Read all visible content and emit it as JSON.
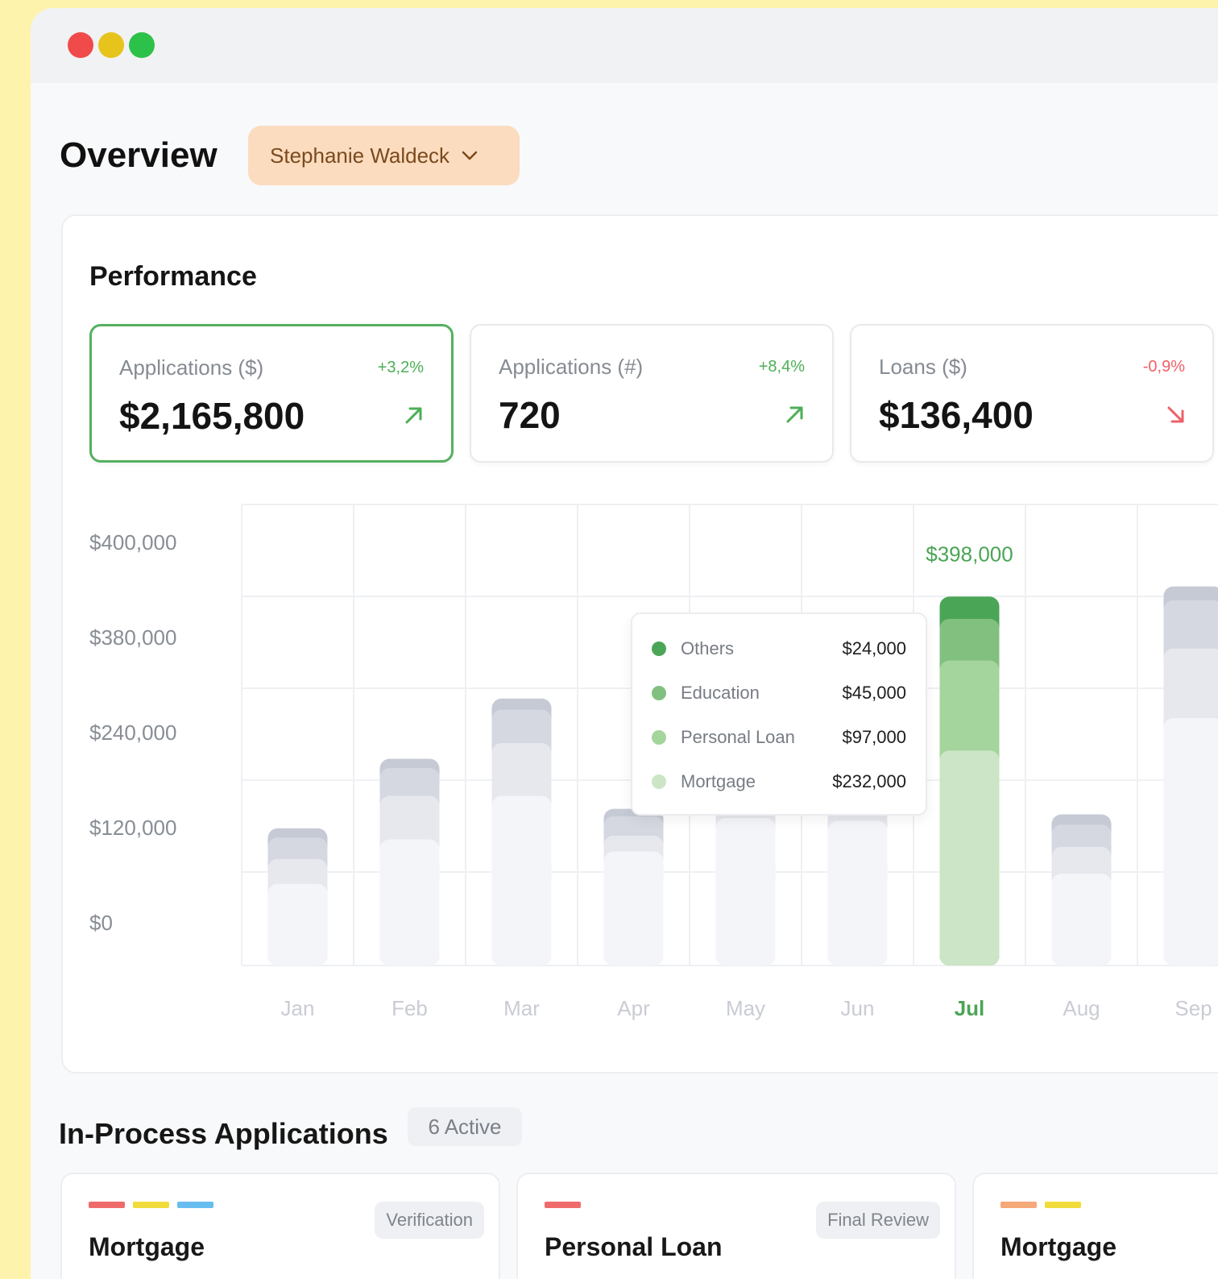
{
  "window": {
    "traffic_lights": {
      "close": "#f04a4a",
      "minimize": "#e7c41c",
      "maximize": "#2cc24a"
    }
  },
  "header": {
    "title": "Overview",
    "user_select": {
      "value": "Stephanie Waldeck",
      "icon": "chevron-down-icon"
    }
  },
  "performance": {
    "title": "Performance",
    "kpis": [
      {
        "label": "Applications ($)",
        "change": "+3,2%",
        "value": "$2,165,800",
        "trend": "up",
        "active": true
      },
      {
        "label": "Applications (#)",
        "change": "+8,4%",
        "value": "720",
        "trend": "up",
        "active": false
      },
      {
        "label": "Loans ($)",
        "change": "-0,9%",
        "value": "$136,400",
        "trend": "down",
        "active": false
      }
    ]
  },
  "chart_data": {
    "type": "bar",
    "stacked": true,
    "y_tick_labels": [
      "$400,000",
      "$380,000",
      "$240,000",
      "$120,000",
      "$0"
    ],
    "categories": [
      "Jan",
      "Feb",
      "Mar",
      "Apr",
      "May",
      "Jun",
      "Jul",
      "Aug",
      "Sep"
    ],
    "highlight_category": "Jul",
    "highlight_total_label": "$398,000",
    "series": [
      {
        "name": "Mortgage",
        "values": [
          88000,
          136000,
          183000,
          123000,
          159000,
          156000,
          232000,
          99000,
          267000
        ]
      },
      {
        "name": "Personal Loan",
        "values": [
          27000,
          47000,
          57000,
          17000,
          28000,
          26000,
          97000,
          29000,
          75000
        ]
      },
      {
        "name": "Education",
        "values": [
          23000,
          30000,
          36000,
          21000,
          20000,
          19000,
          45000,
          24000,
          52000
        ]
      },
      {
        "name": "Others",
        "values": [
          10000,
          10000,
          12000,
          8000,
          6000,
          5000,
          24000,
          11000,
          15000
        ]
      }
    ],
    "colors_active": [
      "#cce5c6",
      "#a4d59c",
      "#82c07f",
      "#4ba556"
    ],
    "colors_inactive": [
      "#f3f5f9",
      "#e6e8ee",
      "#d5d8e0",
      "#c6cad5"
    ],
    "grid": true,
    "tooltip": {
      "rows": [
        {
          "name": "Others",
          "value": "$24,000",
          "color": "#4ba556"
        },
        {
          "name": "Education",
          "value": "$45,000",
          "color": "#82c07f"
        },
        {
          "name": "Personal Loan",
          "value": "$97,000",
          "color": "#a4d59c"
        },
        {
          "name": "Mortgage",
          "value": "$232,000",
          "color": "#cce5c6"
        }
      ]
    }
  },
  "in_process": {
    "title": "In-Process Applications",
    "count_label": "6 Active",
    "cards": [
      {
        "name": "Mortgage",
        "stage": "Verification",
        "stripes": [
          "#ef6b6b",
          "#f2dc3c",
          "#68bdf0"
        ]
      },
      {
        "name": "Personal Loan",
        "stage": "Final Review",
        "stripes": [
          "#ef6b6b"
        ]
      },
      {
        "name": "Mortgage",
        "stage": "",
        "stripes": [
          "#f5a878",
          "#f2dc3c"
        ]
      }
    ]
  }
}
